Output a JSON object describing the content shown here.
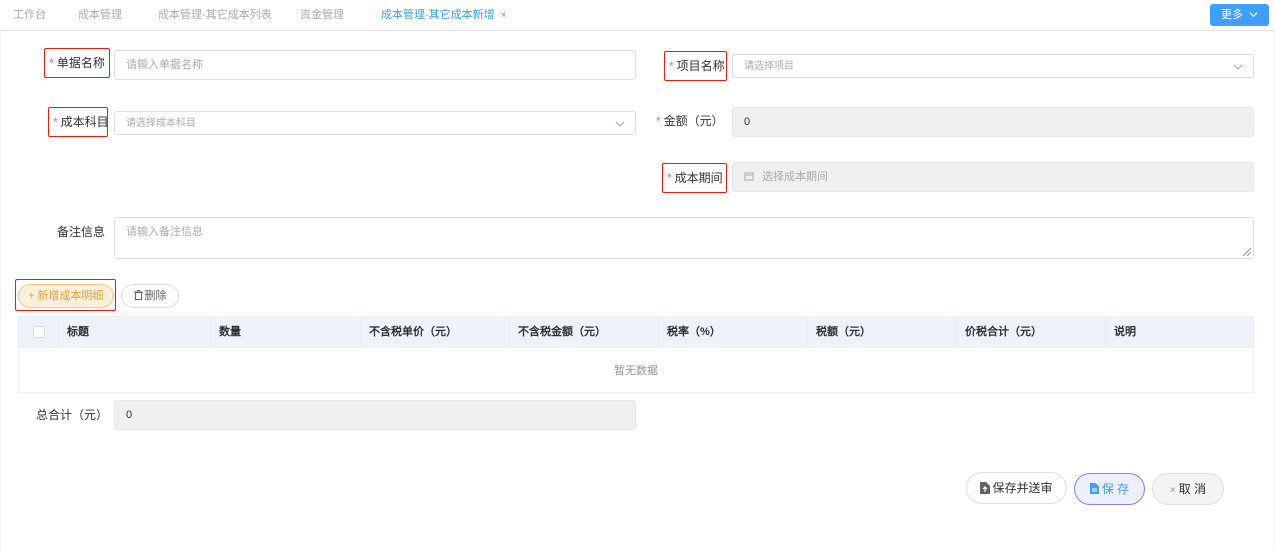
{
  "tabs": [
    {
      "label": "工作台"
    },
    {
      "label": "成本管理"
    },
    {
      "label": "成本管理-其它成本列表"
    },
    {
      "label": "资金管理"
    },
    {
      "label": "成本管理-其它成本新增",
      "close": "×"
    }
  ],
  "more_button": "更多",
  "form": {
    "doc_name": {
      "label": "单据名称",
      "placeholder": "请输入单据名称"
    },
    "project": {
      "label": "项目名称",
      "placeholder": "请选择项目"
    },
    "cost_subject": {
      "label": "成本科目",
      "placeholder": "请选择成本科目"
    },
    "amount": {
      "label": "金额（元）",
      "value": "0"
    },
    "cost_period": {
      "label": "成本期间",
      "placeholder": "选择成本期间"
    },
    "remark": {
      "label": "备注信息",
      "placeholder": "请输入备注信息"
    },
    "required_mark": "*"
  },
  "toolbar": {
    "add_label": "新增成本明细",
    "add_icon": "+",
    "delete_label": "删除"
  },
  "table": {
    "columns": [
      "标题",
      "数量",
      "不含税单价（元）",
      "不含税金额（元）",
      "税率（%）",
      "税额（元）",
      "价税合计（元）",
      "说明"
    ],
    "empty_text": "暂无数据"
  },
  "total": {
    "label": "总合计（元）",
    "value": "0"
  },
  "footer": {
    "submit_label": "保存并送审",
    "save_label": "保 存",
    "cancel_label": "取 消",
    "cancel_icon": "×"
  },
  "colors": {
    "accent": "#409eff",
    "required": "#f56c6c",
    "highlight_border": "#e0201f",
    "add_button": "#e6a23c"
  }
}
